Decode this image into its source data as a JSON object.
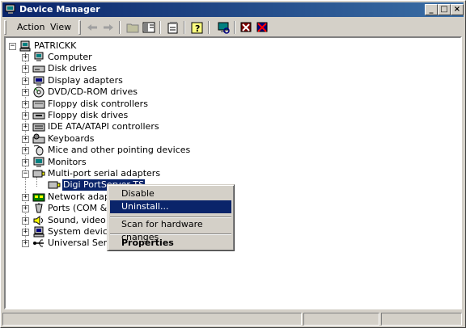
{
  "window": {
    "title": "Device Manager"
  },
  "caption_buttons": {
    "minimize": "_",
    "maximize": "□",
    "close": "×"
  },
  "menu": {
    "action": "Action",
    "view": "View"
  },
  "toolbar": {
    "buttons": [
      "back-icon",
      "forward-icon",
      "up-folder-icon",
      "show-hide-tree-icon",
      "properties-icon",
      "help-icon",
      "scan-hardware-icon",
      "uninstall-icon",
      "disable-icon"
    ]
  },
  "tree": {
    "root": "PATRICKK",
    "categories": [
      {
        "label": "Computer",
        "icon": "computer-icon",
        "expanded": false
      },
      {
        "label": "Disk drives",
        "icon": "disk-drive-icon",
        "expanded": false
      },
      {
        "label": "Display adapters",
        "icon": "display-adapter-icon",
        "expanded": false
      },
      {
        "label": "DVD/CD-ROM drives",
        "icon": "cdrom-icon",
        "expanded": false
      },
      {
        "label": "Floppy disk controllers",
        "icon": "floppy-controller-icon",
        "expanded": false
      },
      {
        "label": "Floppy disk drives",
        "icon": "floppy-drive-icon",
        "expanded": false
      },
      {
        "label": "IDE ATA/ATAPI controllers",
        "icon": "ide-controller-icon",
        "expanded": false
      },
      {
        "label": "Keyboards",
        "icon": "keyboard-icon",
        "expanded": false
      },
      {
        "label": "Mice and other pointing devices",
        "icon": "mouse-icon",
        "expanded": false
      },
      {
        "label": "Monitors",
        "icon": "monitor-icon",
        "expanded": false
      },
      {
        "label": "Multi-port serial adapters",
        "icon": "serial-adapter-icon",
        "expanded": true
      },
      {
        "label": "Network adapter",
        "icon": "network-adapter-icon",
        "expanded": false
      },
      {
        "label": "Ports (COM & LP",
        "icon": "port-icon",
        "expanded": false
      },
      {
        "label": "Sound, video and",
        "icon": "sound-icon",
        "expanded": false
      },
      {
        "label": "System devices",
        "icon": "system-device-icon",
        "expanded": false
      },
      {
        "label": "Universal Serial B",
        "icon": "usb-icon",
        "expanded": false
      }
    ],
    "selected_child": "Digi PortServer TS"
  },
  "context_menu": {
    "disable": "Disable",
    "uninstall": "Uninstall...",
    "scan": "Scan for hardware changes",
    "properties": "Properties"
  },
  "colors": {
    "selection": "#0a246a",
    "face": "#d4d0c8"
  }
}
